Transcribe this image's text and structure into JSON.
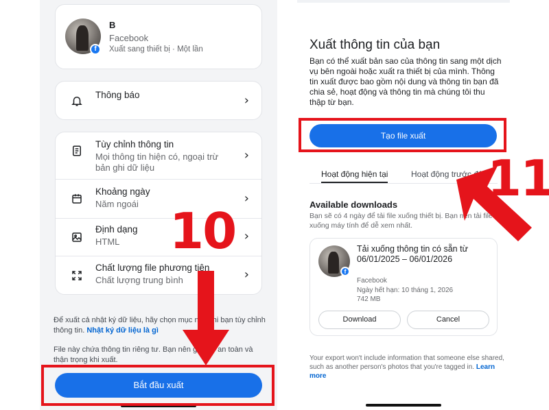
{
  "left": {
    "account": {
      "name": "B",
      "platform": "Facebook",
      "destination": "Xuất sang thiết bị · Một lần"
    },
    "notifications": {
      "label": "Thông báo"
    },
    "options": [
      {
        "title": "Tùy chỉnh thông tin",
        "desc": "Mọi thông tin hiện có, ngoại trừ bản ghi dữ liệu",
        "icon": "document-icon"
      },
      {
        "title": "Khoảng ngày",
        "desc": "Năm ngoái",
        "icon": "calendar-icon"
      },
      {
        "title": "Định dạng",
        "desc": "HTML",
        "icon": "image-icon"
      },
      {
        "title": "Chất lượng file phương tiện",
        "desc": "Chất lượng trung bình",
        "icon": "expand-icon"
      }
    ],
    "note1_text": "Để xuất cả nhật ký dữ liệu, hãy chọn mục này khi bạn tùy chỉnh thông tin.",
    "note1_link": "Nhật ký dữ liệu là gì",
    "note2_text": "File này chứa thông tin riêng tư. Bạn nên giữ file an toàn và thận trọng khi xuất.",
    "start_button": "Bắt đầu xuất",
    "step_number": "10"
  },
  "right": {
    "title": "Xuất thông tin của bạn",
    "description": "Bạn có thể xuất bản sao của thông tin sang một dịch vụ bên ngoài hoặc xuất ra thiết bị của mình. Thông tin xuất được bao gồm nội dung và thông tin bạn đã chia sẻ, hoạt động và thông tin mà chúng tôi thu thập từ bạn.",
    "create_button": "Tạo file xuất",
    "tabs": [
      "Hoạt động hiện tại",
      "Hoạt động trước đây"
    ],
    "downloads_heading": "Available downloads",
    "downloads_note": "Bạn sẽ có 4 ngày để tải file xuống thiết bị. Bạn nên tải file xuống máy tính để dễ xem nhất.",
    "download_card": {
      "title": "Tải xuống thông tin có sẵn từ 06/01/2025 – 06/01/2026",
      "platform": "Facebook",
      "expiry": "Ngày hết hạn: 10 tháng 1, 2026",
      "size": "742 MB",
      "download_button": "Download",
      "cancel_button": "Cancel"
    },
    "footnote_text": "Your export won't include information that someone else shared, such as another person's photos that you're tagged in.",
    "footnote_link": "Learn more",
    "step_number": "11"
  },
  "colors": {
    "accent": "#1870e8",
    "highlight": "#e5141b"
  }
}
